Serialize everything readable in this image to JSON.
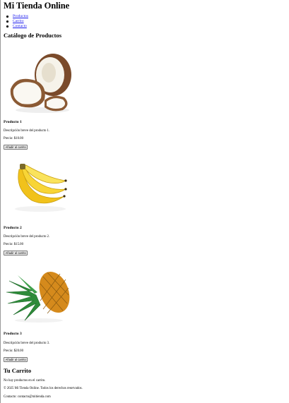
{
  "header": {
    "title": "Mi Tienda Online",
    "nav": [
      "Productos",
      "Carrito",
      "Contacto"
    ]
  },
  "catalog": {
    "heading": "Catálogo de Productos",
    "products": [
      {
        "name": "Producto 1",
        "image_icon": "coconut-image",
        "description": "Descripción breve del producto 1.",
        "price": "Precio: $10.00",
        "button": "Añadir al carrito"
      },
      {
        "name": "Producto 2",
        "image_icon": "banana-image",
        "description": "Descripción breve del producto 2.",
        "price": "Precio: $15.00",
        "button": "Añadir al carrito"
      },
      {
        "name": "Producto 3",
        "image_icon": "pineapple-image",
        "description": "Descripción breve del producto 3.",
        "price": "Precio: $20.00",
        "button": "Añadir al carrito"
      }
    ]
  },
  "cart": {
    "heading": "Tu Carrito",
    "empty_text": "No hay productos en el carrito."
  },
  "footer": {
    "copyright": "© 2025 Mi Tienda Online. Todos los derechos reservados.",
    "contact": "Contacto: contacto@mitienda.com"
  }
}
